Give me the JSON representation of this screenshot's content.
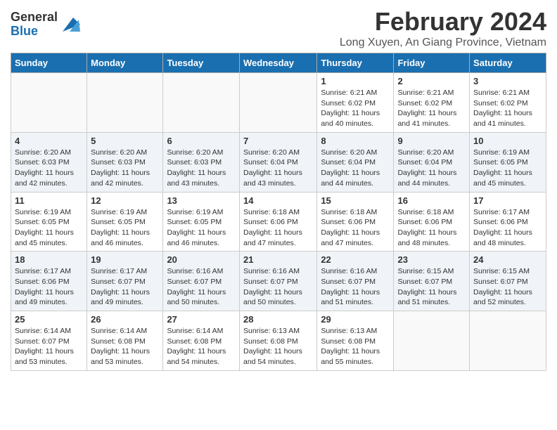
{
  "logo": {
    "general": "General",
    "blue": "Blue"
  },
  "header": {
    "month": "February 2024",
    "location": "Long Xuyen, An Giang Province, Vietnam"
  },
  "days": [
    "Sunday",
    "Monday",
    "Tuesday",
    "Wednesday",
    "Thursday",
    "Friday",
    "Saturday"
  ],
  "weeks": [
    [
      {
        "day": "",
        "info": ""
      },
      {
        "day": "",
        "info": ""
      },
      {
        "day": "",
        "info": ""
      },
      {
        "day": "",
        "info": ""
      },
      {
        "day": "1",
        "info": "Sunrise: 6:21 AM\nSunset: 6:02 PM\nDaylight: 11 hours\nand 40 minutes."
      },
      {
        "day": "2",
        "info": "Sunrise: 6:21 AM\nSunset: 6:02 PM\nDaylight: 11 hours\nand 41 minutes."
      },
      {
        "day": "3",
        "info": "Sunrise: 6:21 AM\nSunset: 6:02 PM\nDaylight: 11 hours\nand 41 minutes."
      }
    ],
    [
      {
        "day": "4",
        "info": "Sunrise: 6:20 AM\nSunset: 6:03 PM\nDaylight: 11 hours\nand 42 minutes."
      },
      {
        "day": "5",
        "info": "Sunrise: 6:20 AM\nSunset: 6:03 PM\nDaylight: 11 hours\nand 42 minutes."
      },
      {
        "day": "6",
        "info": "Sunrise: 6:20 AM\nSunset: 6:03 PM\nDaylight: 11 hours\nand 43 minutes."
      },
      {
        "day": "7",
        "info": "Sunrise: 6:20 AM\nSunset: 6:04 PM\nDaylight: 11 hours\nand 43 minutes."
      },
      {
        "day": "8",
        "info": "Sunrise: 6:20 AM\nSunset: 6:04 PM\nDaylight: 11 hours\nand 44 minutes."
      },
      {
        "day": "9",
        "info": "Sunrise: 6:20 AM\nSunset: 6:04 PM\nDaylight: 11 hours\nand 44 minutes."
      },
      {
        "day": "10",
        "info": "Sunrise: 6:19 AM\nSunset: 6:05 PM\nDaylight: 11 hours\nand 45 minutes."
      }
    ],
    [
      {
        "day": "11",
        "info": "Sunrise: 6:19 AM\nSunset: 6:05 PM\nDaylight: 11 hours\nand 45 minutes."
      },
      {
        "day": "12",
        "info": "Sunrise: 6:19 AM\nSunset: 6:05 PM\nDaylight: 11 hours\nand 46 minutes."
      },
      {
        "day": "13",
        "info": "Sunrise: 6:19 AM\nSunset: 6:05 PM\nDaylight: 11 hours\nand 46 minutes."
      },
      {
        "day": "14",
        "info": "Sunrise: 6:18 AM\nSunset: 6:06 PM\nDaylight: 11 hours\nand 47 minutes."
      },
      {
        "day": "15",
        "info": "Sunrise: 6:18 AM\nSunset: 6:06 PM\nDaylight: 11 hours\nand 47 minutes."
      },
      {
        "day": "16",
        "info": "Sunrise: 6:18 AM\nSunset: 6:06 PM\nDaylight: 11 hours\nand 48 minutes."
      },
      {
        "day": "17",
        "info": "Sunrise: 6:17 AM\nSunset: 6:06 PM\nDaylight: 11 hours\nand 48 minutes."
      }
    ],
    [
      {
        "day": "18",
        "info": "Sunrise: 6:17 AM\nSunset: 6:06 PM\nDaylight: 11 hours\nand 49 minutes."
      },
      {
        "day": "19",
        "info": "Sunrise: 6:17 AM\nSunset: 6:07 PM\nDaylight: 11 hours\nand 49 minutes."
      },
      {
        "day": "20",
        "info": "Sunrise: 6:16 AM\nSunset: 6:07 PM\nDaylight: 11 hours\nand 50 minutes."
      },
      {
        "day": "21",
        "info": "Sunrise: 6:16 AM\nSunset: 6:07 PM\nDaylight: 11 hours\nand 50 minutes."
      },
      {
        "day": "22",
        "info": "Sunrise: 6:16 AM\nSunset: 6:07 PM\nDaylight: 11 hours\nand 51 minutes."
      },
      {
        "day": "23",
        "info": "Sunrise: 6:15 AM\nSunset: 6:07 PM\nDaylight: 11 hours\nand 51 minutes."
      },
      {
        "day": "24",
        "info": "Sunrise: 6:15 AM\nSunset: 6:07 PM\nDaylight: 11 hours\nand 52 minutes."
      }
    ],
    [
      {
        "day": "25",
        "info": "Sunrise: 6:14 AM\nSunset: 6:07 PM\nDaylight: 11 hours\nand 53 minutes."
      },
      {
        "day": "26",
        "info": "Sunrise: 6:14 AM\nSunset: 6:08 PM\nDaylight: 11 hours\nand 53 minutes."
      },
      {
        "day": "27",
        "info": "Sunrise: 6:14 AM\nSunset: 6:08 PM\nDaylight: 11 hours\nand 54 minutes."
      },
      {
        "day": "28",
        "info": "Sunrise: 6:13 AM\nSunset: 6:08 PM\nDaylight: 11 hours\nand 54 minutes."
      },
      {
        "day": "29",
        "info": "Sunrise: 6:13 AM\nSunset: 6:08 PM\nDaylight: 11 hours\nand 55 minutes."
      },
      {
        "day": "",
        "info": ""
      },
      {
        "day": "",
        "info": ""
      }
    ]
  ]
}
